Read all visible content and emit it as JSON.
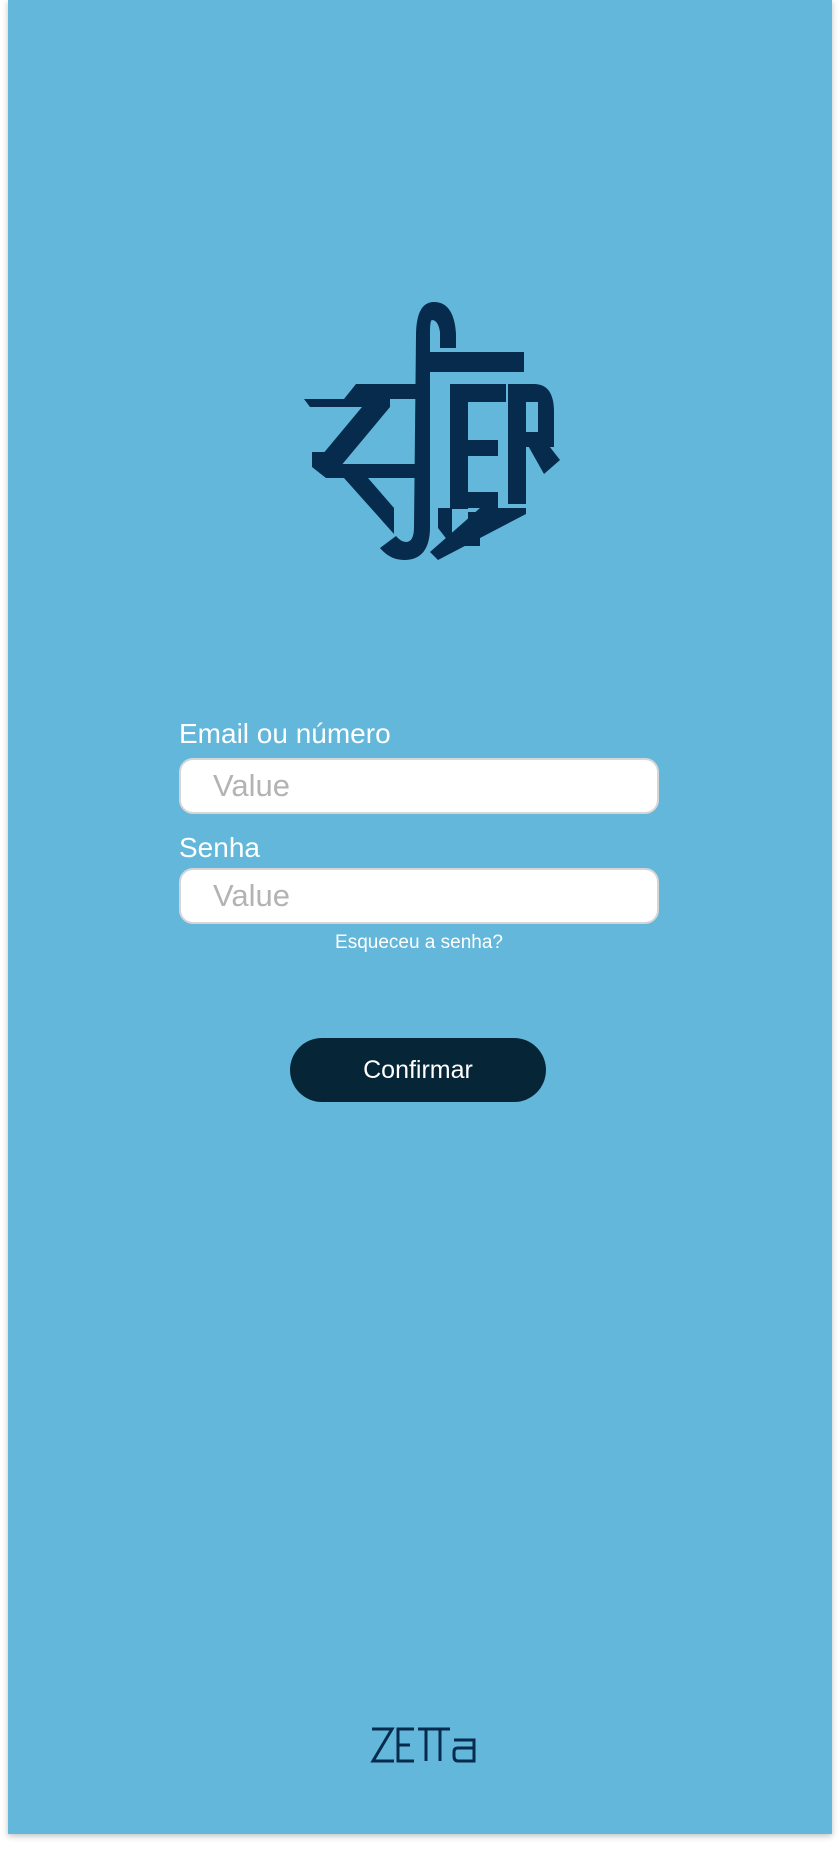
{
  "colors": {
    "background": "#63b7da",
    "logo": "#062b4d",
    "button": "#062638",
    "text": "#ffffff"
  },
  "logo": {
    "icon": "zfer-logo-icon",
    "text": "ZFER"
  },
  "form": {
    "email_label": "Email ou número",
    "email_placeholder": "Value",
    "password_label": "Senha",
    "password_placeholder": "Value",
    "forgot_link": "Esqueceu a senha?",
    "confirm_label": "Confirmar"
  },
  "footer": {
    "brand_icon": "zetta-wordmark-icon",
    "brand_text": "ZETTA"
  }
}
